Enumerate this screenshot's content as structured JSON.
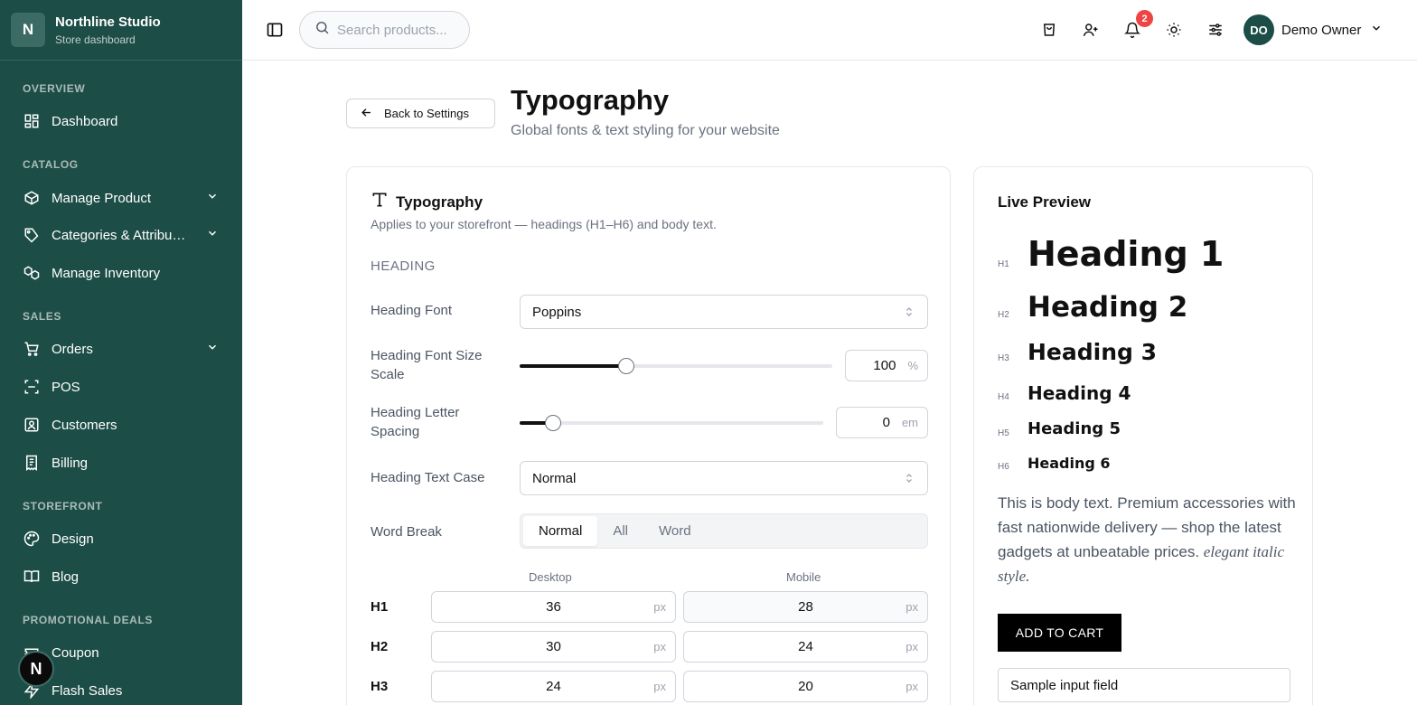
{
  "brand": {
    "initial": "N",
    "name": "Northline Studio",
    "subtitle": "Store dashboard"
  },
  "sidebar": {
    "groups": [
      {
        "title": "OVERVIEW"
      },
      {
        "title": "CATALOG"
      },
      {
        "title": "SALES"
      },
      {
        "title": "STOREFRONT"
      },
      {
        "title": "PROMOTIONAL DEALS"
      }
    ],
    "items": [
      {
        "label": "Dashboard",
        "icon": "grid-icon"
      },
      {
        "label": "Manage Product",
        "icon": "box-icon",
        "expandable": true
      },
      {
        "label": "Categories & Attributes",
        "icon": "tag-icon",
        "expandable": true
      },
      {
        "label": "Manage Inventory",
        "icon": "boxes-icon"
      },
      {
        "label": "Orders",
        "icon": "cart-icon",
        "expandable": true
      },
      {
        "label": "POS",
        "icon": "scan-icon"
      },
      {
        "label": "Customers",
        "icon": "user-card-icon"
      },
      {
        "label": "Billing",
        "icon": "receipt-icon"
      },
      {
        "label": "Design",
        "icon": "palette-icon"
      },
      {
        "label": "Blog",
        "icon": "book-icon"
      },
      {
        "label": "Coupon",
        "icon": "ticket-icon"
      },
      {
        "label": "Flash Sales",
        "icon": "zap-icon"
      }
    ],
    "fab_label": "N"
  },
  "topbar": {
    "search_placeholder": "Search products...",
    "notification_count": "2",
    "user_initials": "DO",
    "user_name": "Demo Owner"
  },
  "header": {
    "back_label": "Back to Settings",
    "title": "Typography",
    "subtitle": "Global fonts & text styling for your website"
  },
  "settings": {
    "title": "Typography",
    "subtitle": "Applies to your storefront — headings (H1–H6) and body text.",
    "section": "HEADING",
    "heading_font": {
      "label": "Heading Font",
      "value": "Poppins"
    },
    "size_scale": {
      "label": "Heading Font Size Scale",
      "value": "100",
      "unit": "%",
      "fraction": 0.34
    },
    "letter_spacing": {
      "label": "Heading Letter Spacing",
      "value": "0",
      "unit": "em",
      "fraction": 0.11
    },
    "text_case": {
      "label": "Heading Text Case",
      "value": "Normal"
    },
    "word_break": {
      "label": "Word Break",
      "options": [
        "Normal",
        "All",
        "Word"
      ],
      "selected": "Normal"
    },
    "columns": {
      "desktop": "Desktop",
      "mobile": "Mobile"
    },
    "sizes": [
      {
        "label": "H1",
        "desktop": "36",
        "mobile": "28",
        "unit": "px"
      },
      {
        "label": "H2",
        "desktop": "30",
        "mobile": "24",
        "unit": "px"
      },
      {
        "label": "H3",
        "desktop": "24",
        "mobile": "20",
        "unit": "px"
      }
    ]
  },
  "preview": {
    "title": "Live Preview",
    "headings": [
      {
        "tag": "H1",
        "text": "Heading 1"
      },
      {
        "tag": "H2",
        "text": "Heading 2"
      },
      {
        "tag": "H3",
        "text": "Heading 3"
      },
      {
        "tag": "H4",
        "text": "Heading 4"
      },
      {
        "tag": "H5",
        "text": "Heading 5"
      },
      {
        "tag": "H6",
        "text": "Heading 6"
      }
    ],
    "body_text": "This is body text. Premium accessories with fast nationwide delivery — shop the latest gadgets at unbeatable prices.",
    "body_italic": "elegant italic style.",
    "button_label": "ADD TO CART",
    "input_value": "Sample input field"
  },
  "colors": {
    "sidebar": "#1d4d47",
    "accent_dark": "#000000",
    "badge": "#ef4444"
  }
}
